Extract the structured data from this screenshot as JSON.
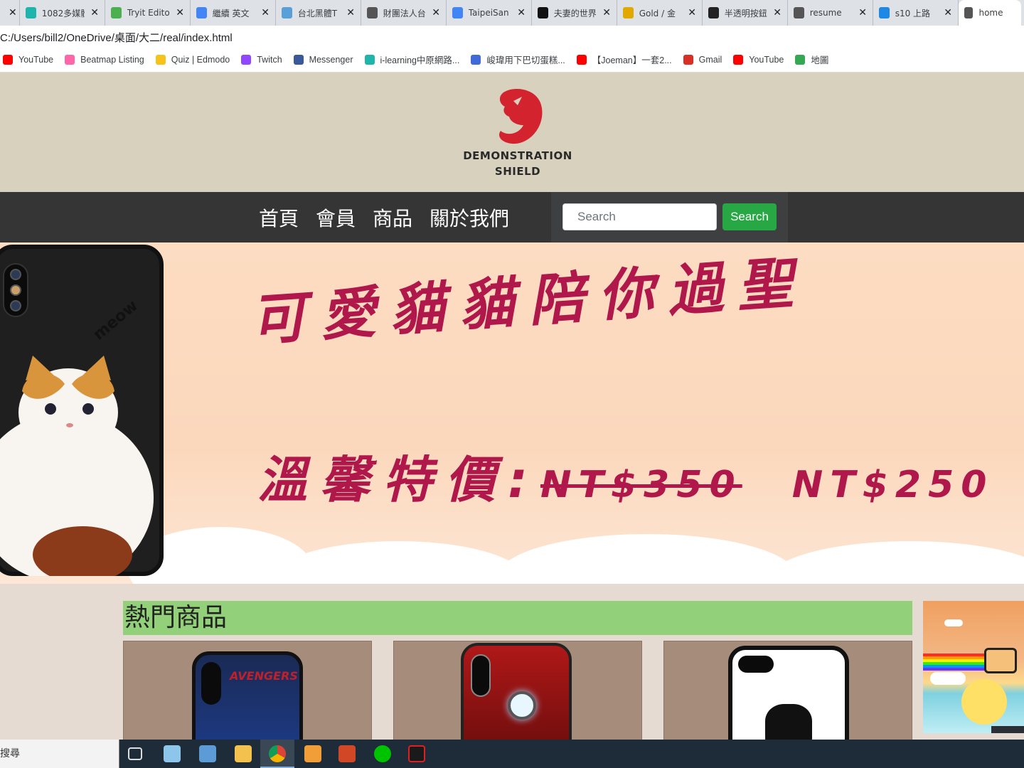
{
  "browser": {
    "tabs": [
      {
        "title": "",
        "icon": "close-x",
        "color": "#dee1e6"
      },
      {
        "title": "1082多媒體",
        "icon": "m-icon",
        "color": "#1fb5ad"
      },
      {
        "title": "Tryit Edito",
        "icon": "w3-icon",
        "color": "#4caf50"
      },
      {
        "title": "繼續 英文",
        "icon": "google-icon",
        "color": "#4285f4"
      },
      {
        "title": "台北黑體T",
        "icon": "pk-icon",
        "color": "#5aa0d8"
      },
      {
        "title": "財團法人台",
        "icon": "globe-icon",
        "color": "#555555"
      },
      {
        "title": "TaipeiSan",
        "icon": "doc-icon",
        "color": "#4285f4"
      },
      {
        "title": "夫妻的世界",
        "icon": "d-icon",
        "color": "#111111"
      },
      {
        "title": "Gold / 金",
        "icon": "book-icon",
        "color": "#e0a800"
      },
      {
        "title": "半透明按鈕",
        "icon": "codepen-icon",
        "color": "#222222"
      },
      {
        "title": "resume",
        "icon": "globe-icon",
        "color": "#555555"
      },
      {
        "title": "s10 上路",
        "icon": "garena-icon",
        "color": "#1e88e5"
      },
      {
        "title": "home",
        "icon": "globe-icon",
        "color": "#555555",
        "active": true
      }
    ],
    "address": "C:/Users/bill2/OneDrive/桌面/大二/real/index.html",
    "bookmarks": [
      {
        "label": "YouTube",
        "icon": "youtube-icon",
        "color": "#ff0000"
      },
      {
        "label": "Beatmap Listing",
        "icon": "osu-icon",
        "color": "#ff66aa"
      },
      {
        "label": "Quiz | Edmodo",
        "icon": "edmodo-icon",
        "color": "#f6c21b"
      },
      {
        "label": "Twitch",
        "icon": "twitch-icon",
        "color": "#9146ff"
      },
      {
        "label": "Messenger",
        "icon": "facebook-icon",
        "color": "#3b5998"
      },
      {
        "label": "i-learning中原網路...",
        "icon": "m-icon",
        "color": "#1fb5ad"
      },
      {
        "label": "峻瑋用下巴切蛋糕...",
        "icon": "c-icon",
        "color": "#3f6ad8"
      },
      {
        "label": "【Joeman】一套2...",
        "icon": "youtube-icon",
        "color": "#ff0000"
      },
      {
        "label": "Gmail",
        "icon": "gmail-icon",
        "color": "#d93025"
      },
      {
        "label": "YouTube",
        "icon": "youtube-icon",
        "color": "#ff0000"
      },
      {
        "label": "地圖",
        "icon": "maps-icon",
        "color": "#34a853"
      }
    ]
  },
  "site": {
    "logo_line1": "DEMONSTRATION",
    "logo_line2": "SHIELD",
    "logo_color": "#d3232f",
    "nav": [
      "首頁",
      "會員",
      "商品",
      "關於我們"
    ],
    "search_placeholder": "Search",
    "search_button": "Search",
    "banner": {
      "title": "可愛貓貓陪你過聖",
      "price_label": "溫馨特價:",
      "old_price": "NT$350",
      "new_price": "NT$250",
      "phone_text": "meow"
    },
    "hot_section_title": "熱門商品",
    "products": [
      {
        "name": "Avengers phone case",
        "text": "AVENGERS"
      },
      {
        "name": "Iron Man phone case"
      },
      {
        "name": "Sketch face phone case"
      }
    ]
  },
  "taskbar": {
    "search_text": "搜尋"
  }
}
